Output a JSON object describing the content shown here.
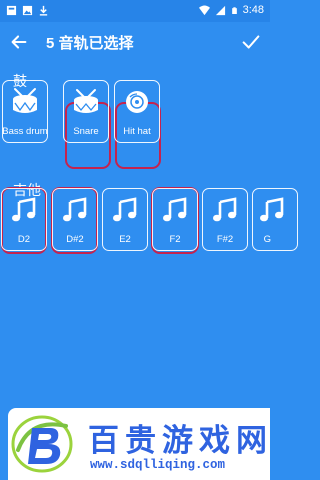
{
  "status_bar": {
    "left_icons": [
      "notification-box-icon",
      "image-icon",
      "download-icon"
    ],
    "right_icons": [
      "wifi-icon",
      "cellular-signal-icon",
      "battery-icon"
    ],
    "time": "3:48"
  },
  "app_bar": {
    "back_icon": "arrow-left-icon",
    "title": "5 音轨已选择",
    "confirm_icon": "checkmark-icon"
  },
  "sections": {
    "drums": {
      "title": "鼓",
      "items": [
        {
          "label": "Bass drum",
          "icon": "bass-drum-icon",
          "selected": false
        },
        {
          "label": "Snare",
          "icon": "snare-drum-icon",
          "selected": true
        },
        {
          "label": "Hit hat",
          "icon": "hi-hat-icon",
          "selected": true
        }
      ]
    },
    "guitar": {
      "title": "吉他",
      "items": [
        {
          "label": "D2",
          "icon": "music-note-icon",
          "selected": true
        },
        {
          "label": "D#2",
          "icon": "music-note-icon",
          "selected": true
        },
        {
          "label": "E2",
          "icon": "music-note-icon",
          "selected": false
        },
        {
          "label": "F2",
          "icon": "music-note-icon",
          "selected": true
        },
        {
          "label": "F#2",
          "icon": "music-note-icon",
          "selected": false
        },
        {
          "label": "G",
          "icon": "music-note-icon",
          "selected": false
        }
      ]
    }
  },
  "watermark": {
    "title": "百贵游戏网",
    "url": "www.sdqlliqing.com"
  },
  "colors": {
    "background": "#2f8ef0",
    "status_bar": "#2784e8",
    "selection_ring": "#c4234f",
    "watermark_text": "#2f63e0"
  }
}
